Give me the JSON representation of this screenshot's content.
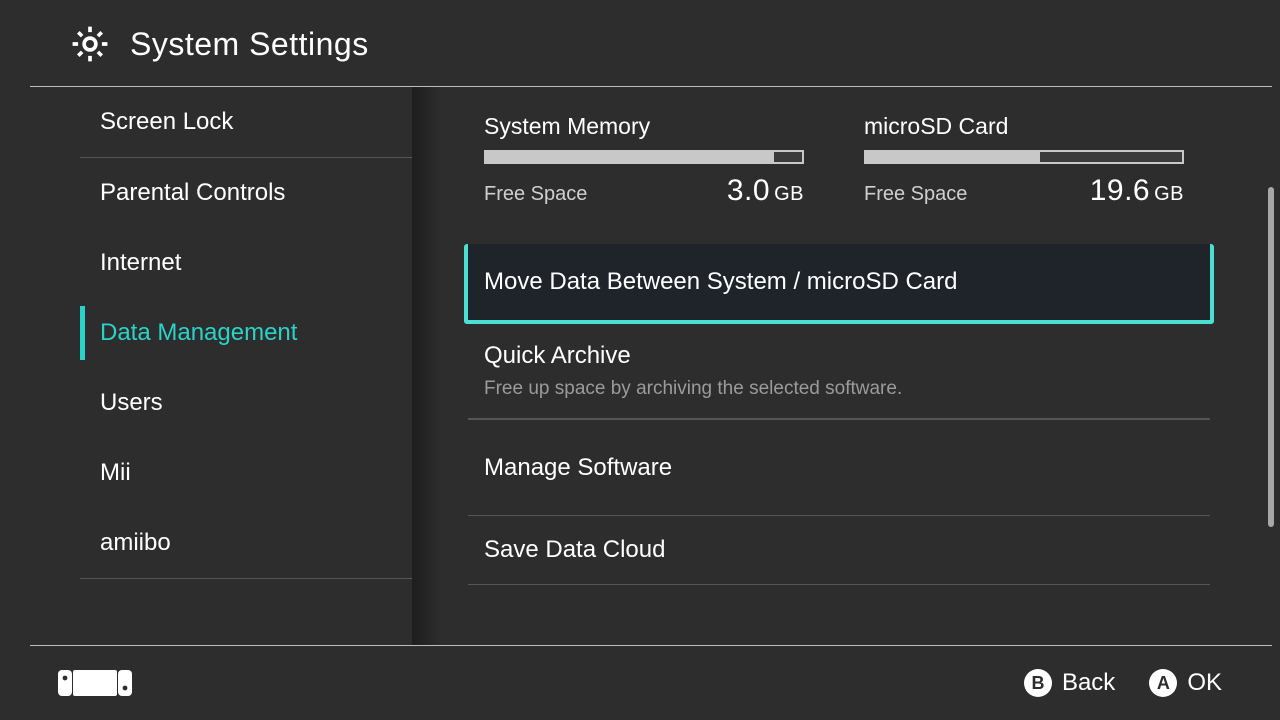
{
  "header": {
    "title": "System Settings"
  },
  "sidebar": {
    "items": [
      {
        "label": "Screen Lock",
        "selected": false
      },
      {
        "label": "Parental Controls",
        "selected": false
      },
      {
        "label": "Internet",
        "selected": false
      },
      {
        "label": "Data Management",
        "selected": true
      },
      {
        "label": "Users",
        "selected": false
      },
      {
        "label": "Mii",
        "selected": false
      },
      {
        "label": "amiibo",
        "selected": false
      }
    ]
  },
  "storage": {
    "free_space_label": "Free Space",
    "system": {
      "title": "System Memory",
      "value": "3.0",
      "unit": "GB",
      "fill_percent": 91
    },
    "sd": {
      "title": "microSD Card",
      "value": "19.6",
      "unit": "GB",
      "fill_percent": 55
    }
  },
  "options": {
    "move_data": "Move Data Between System / microSD Card",
    "quick_archive": "Quick Archive",
    "quick_archive_sub": "Free up space by archiving the selected software.",
    "manage_software": "Manage Software",
    "save_data_cloud": "Save Data Cloud"
  },
  "footer": {
    "back": {
      "button": "B",
      "label": "Back"
    },
    "ok": {
      "button": "A",
      "label": "OK"
    }
  }
}
